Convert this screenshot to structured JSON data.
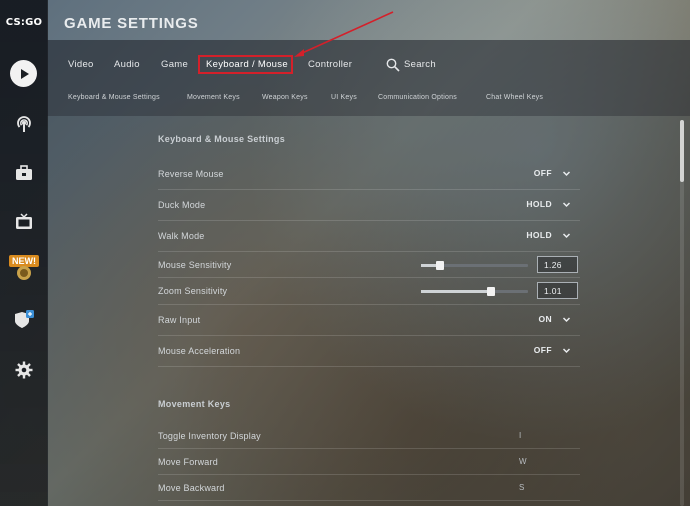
{
  "app": {
    "logo": "CS:GO",
    "title": "GAME SETTINGS"
  },
  "sidebar": {
    "badge": "NEW!",
    "items": [
      {
        "name": "play-icon"
      },
      {
        "name": "broadcast-icon"
      },
      {
        "name": "briefcase-icon"
      },
      {
        "name": "tv-icon"
      },
      {
        "name": "operation-icon"
      },
      {
        "name": "shield-icon"
      },
      {
        "name": "gear-icon"
      }
    ]
  },
  "tabs": [
    "Video",
    "Audio",
    "Game",
    "Keyboard / Mouse",
    "Controller"
  ],
  "active_tab": "Keyboard / Mouse",
  "search_label": "Search",
  "subtabs": [
    "Keyboard & Mouse Settings",
    "Movement Keys",
    "Weapon Keys",
    "UI Keys",
    "Communication Options",
    "Chat Wheel Keys"
  ],
  "section1": {
    "title": "Keyboard & Mouse Settings",
    "rows": [
      {
        "label": "Reverse Mouse",
        "value": "OFF"
      },
      {
        "label": "Duck Mode",
        "value": "HOLD"
      },
      {
        "label": "Walk Mode",
        "value": "HOLD"
      },
      {
        "label": "Mouse Sensitivity",
        "value": "1.26",
        "slider_fraction": 0.18
      },
      {
        "label": "Zoom Sensitivity",
        "value": "1.01",
        "slider_fraction": 0.65
      },
      {
        "label": "Raw Input",
        "value": "ON"
      },
      {
        "label": "Mouse Acceleration",
        "value": "OFF"
      }
    ]
  },
  "section2": {
    "title": "Movement Keys",
    "rows": [
      {
        "label": "Toggle Inventory Display",
        "key": "I"
      },
      {
        "label": "Move Forward",
        "key": "W"
      },
      {
        "label": "Move Backward",
        "key": "S"
      }
    ]
  },
  "colors": {
    "highlight": "#d4202a",
    "badge": "#d98b1f"
  }
}
